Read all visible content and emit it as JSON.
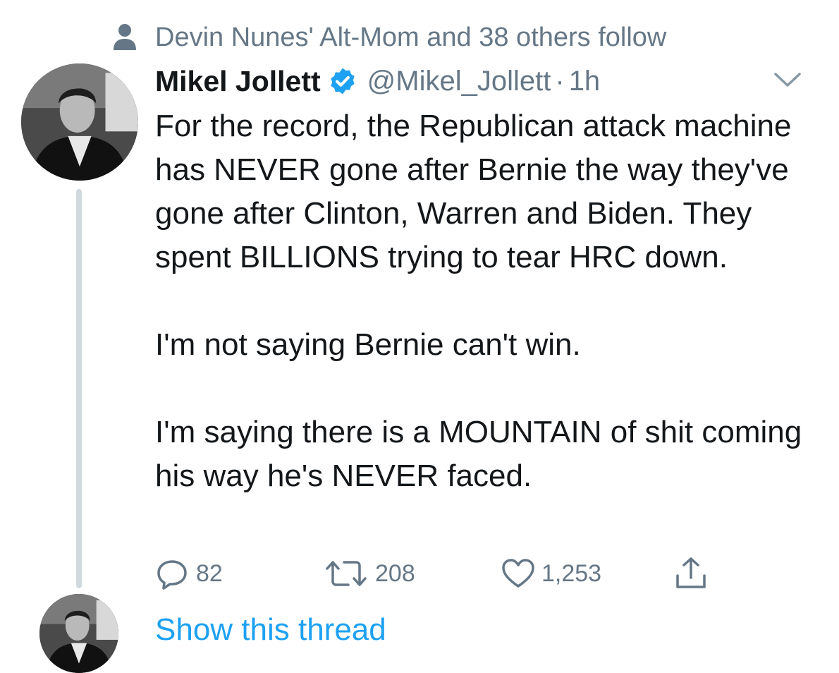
{
  "social_context": {
    "icon": "person-icon",
    "text": "Devin Nunes' Alt-Mom and 38 others follow"
  },
  "tweet": {
    "display_name": "Mikel Jollett",
    "verified": true,
    "handle": "@Mikel_Jollett",
    "separator": "·",
    "time": "1h",
    "paragraphs": [
      "For the record, the Republican attack machine has NEVER gone after Bernie the way they've gone after Clinton, Warren and Biden. They spent BILLIONS trying to tear HRC down.",
      "I'm not saying Bernie can't win.",
      "I'm saying there is a MOUNTAIN of shit coming his way he's NEVER faced."
    ],
    "actions": {
      "replies": "82",
      "retweets": "208",
      "likes": "1,253"
    }
  },
  "show_thread_label": "Show this thread",
  "colors": {
    "text": "#14171a",
    "secondary": "#657786",
    "accent": "#1da1f2",
    "thread_line": "#cfd9de"
  }
}
